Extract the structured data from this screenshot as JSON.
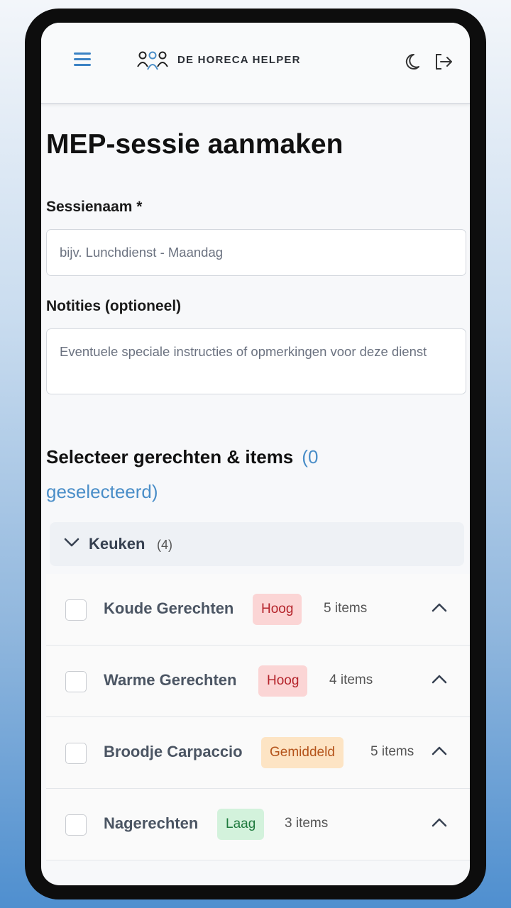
{
  "app": {
    "brand": "DE HORECA HELPER",
    "icons": {
      "menu": "menu-icon",
      "logo": "people-logo-icon",
      "theme": "moon-icon",
      "logout": "logout-icon"
    }
  },
  "page": {
    "title": "MEP-sessie aanmaken"
  },
  "form": {
    "session_name": {
      "label": "Sessienaam *",
      "value": "",
      "placeholder": "bijv. Lunchdienst - Maandag"
    },
    "notes": {
      "label": "Notities (optioneel)",
      "value": "",
      "placeholder": "Eventuele speciale instructies of opmerkingen voor deze dienst"
    }
  },
  "selection": {
    "title": "Selecteer gerechten & items",
    "count_text": "(0 geselecteerd)"
  },
  "groups": [
    {
      "name": "Keuken",
      "count": "(4)",
      "items": [
        {
          "name": "Koude Gerechten",
          "priority": "Hoog",
          "priority_color": "#fbd5d5",
          "priority_text_color": "#b4232a",
          "items_text": "5 items"
        },
        {
          "name": "Warme Gerechten",
          "priority": "Hoog",
          "priority_color": "#fbd5d5",
          "priority_text_color": "#b4232a",
          "items_text": "4 items"
        },
        {
          "name": "Broodje Carpaccio",
          "priority": "Gemiddeld",
          "priority_color": "#fde4c4",
          "priority_text_color": "#b4531a",
          "items_text": "5 items"
        },
        {
          "name": "Nagerechten",
          "priority": "Laag",
          "priority_color": "#d3f2dc",
          "priority_text_color": "#1f7a3e",
          "items_text": "3 items"
        }
      ]
    }
  ],
  "colors": {
    "accent": "#3b82c4",
    "link": "#4a8ec8"
  }
}
